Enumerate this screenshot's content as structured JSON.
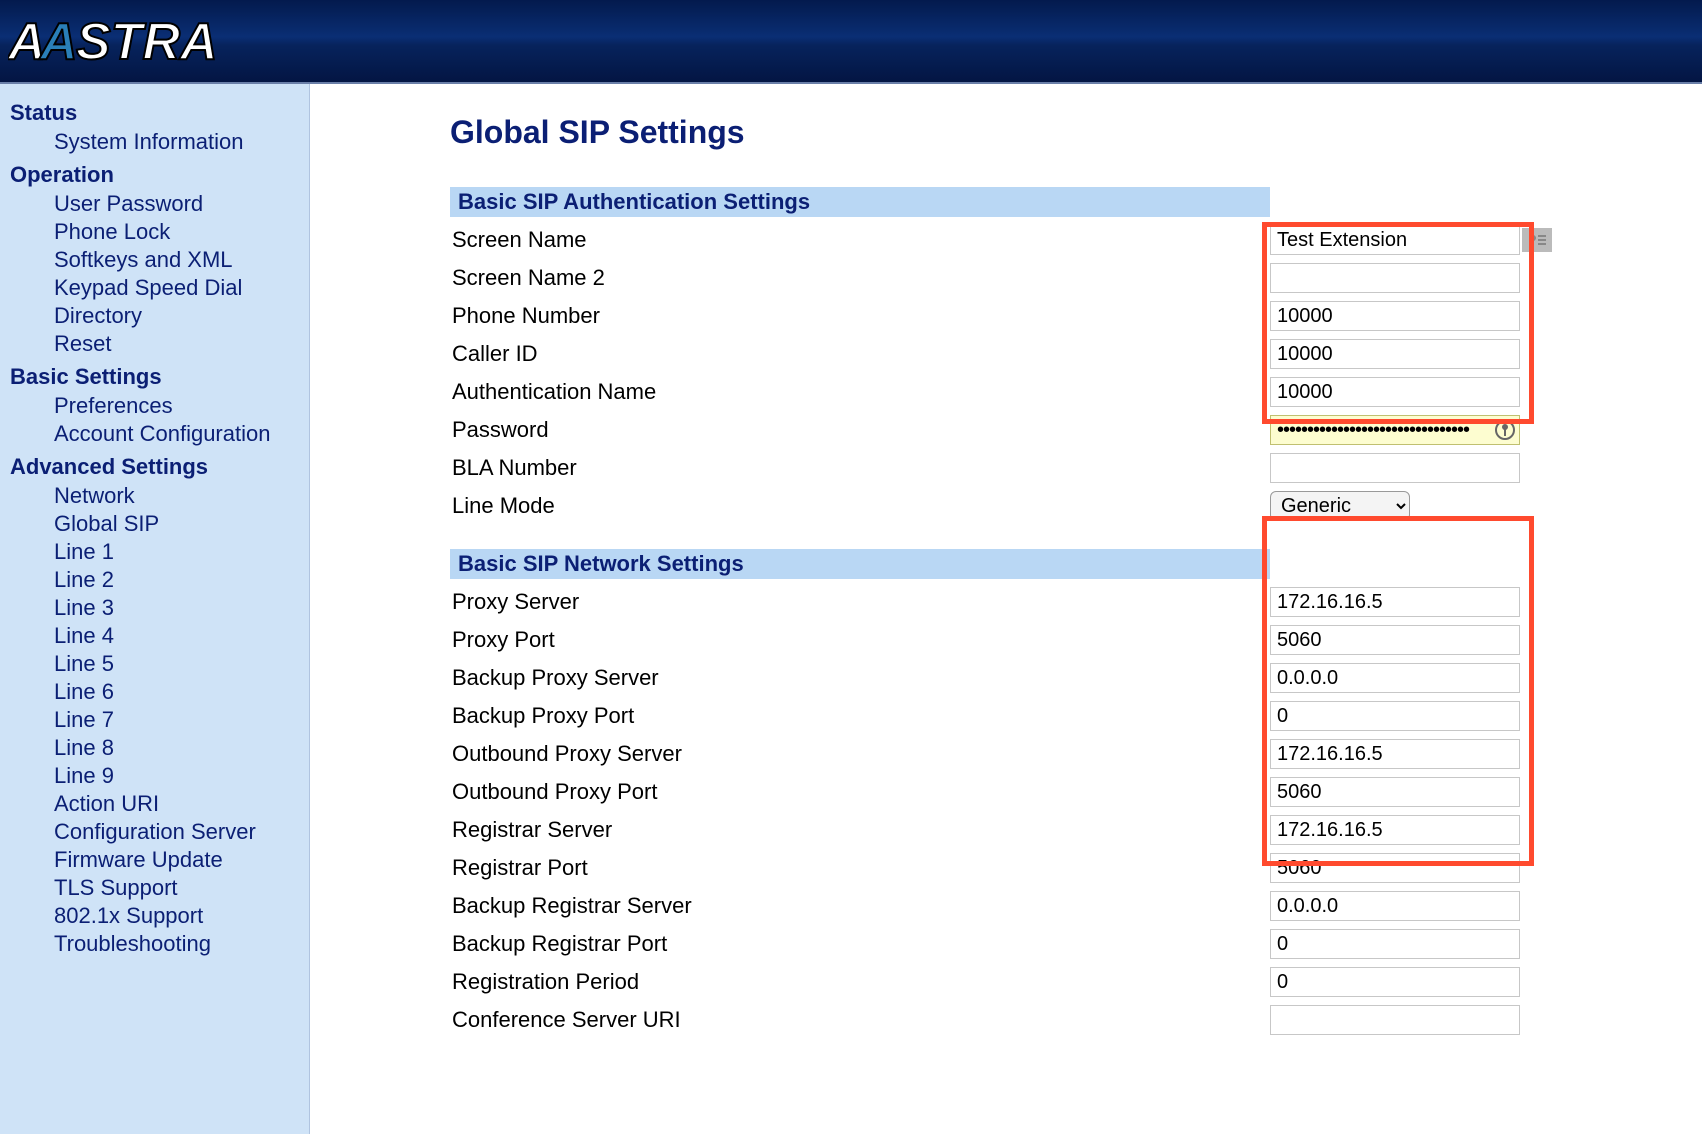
{
  "brand": "AASTRA",
  "sidebar": {
    "groups": [
      {
        "head": "Status",
        "items": [
          "System Information"
        ]
      },
      {
        "head": "Operation",
        "items": [
          "User Password",
          "Phone Lock",
          "Softkeys and XML",
          "Keypad Speed Dial",
          "Directory",
          "Reset"
        ]
      },
      {
        "head": "Basic Settings",
        "items": [
          "Preferences",
          "Account Configuration"
        ]
      },
      {
        "head": "Advanced Settings",
        "items": [
          "Network",
          "Global SIP",
          "Line 1",
          "Line 2",
          "Line 3",
          "Line 4",
          "Line 5",
          "Line 6",
          "Line 7",
          "Line 8",
          "Line 9",
          "Action URI",
          "Configuration Server",
          "Firmware Update",
          "TLS Support",
          "802.1x Support",
          "Troubleshooting"
        ]
      }
    ]
  },
  "page_title": "Global SIP Settings",
  "auth_section": {
    "title": "Basic SIP Authentication Settings",
    "screen_name_label": "Screen Name",
    "screen_name_value": "Test Extension",
    "screen_name2_label": "Screen Name 2",
    "screen_name2_value": "",
    "phone_number_label": "Phone Number",
    "phone_number_value": "10000",
    "caller_id_label": "Caller ID",
    "caller_id_value": "10000",
    "auth_name_label": "Authentication Name",
    "auth_name_value": "10000",
    "password_label": "Password",
    "password_value": "••••••••••••••••••••••••••••••••",
    "bla_label": "BLA Number",
    "bla_value": "",
    "line_mode_label": "Line Mode",
    "line_mode_value": "Generic"
  },
  "net_section": {
    "title": "Basic SIP Network Settings",
    "proxy_server_label": "Proxy Server",
    "proxy_server_value": "172.16.16.5",
    "proxy_port_label": "Proxy Port",
    "proxy_port_value": "5060",
    "backup_proxy_server_label": "Backup Proxy Server",
    "backup_proxy_server_value": "0.0.0.0",
    "backup_proxy_port_label": "Backup Proxy Port",
    "backup_proxy_port_value": "0",
    "outbound_proxy_server_label": "Outbound Proxy Server",
    "outbound_proxy_server_value": "172.16.16.5",
    "outbound_proxy_port_label": "Outbound Proxy Port",
    "outbound_proxy_port_value": "5060",
    "registrar_server_label": "Registrar Server",
    "registrar_server_value": "172.16.16.5",
    "registrar_port_label": "Registrar Port",
    "registrar_port_value": "5060",
    "backup_registrar_server_label": "Backup Registrar Server",
    "backup_registrar_server_value": "0.0.0.0",
    "backup_registrar_port_label": "Backup Registrar Port",
    "backup_registrar_port_value": "0",
    "registration_period_label": "Registration Period",
    "registration_period_value": "0",
    "conference_uri_label": "Conference Server URI",
    "conference_uri_value": ""
  }
}
